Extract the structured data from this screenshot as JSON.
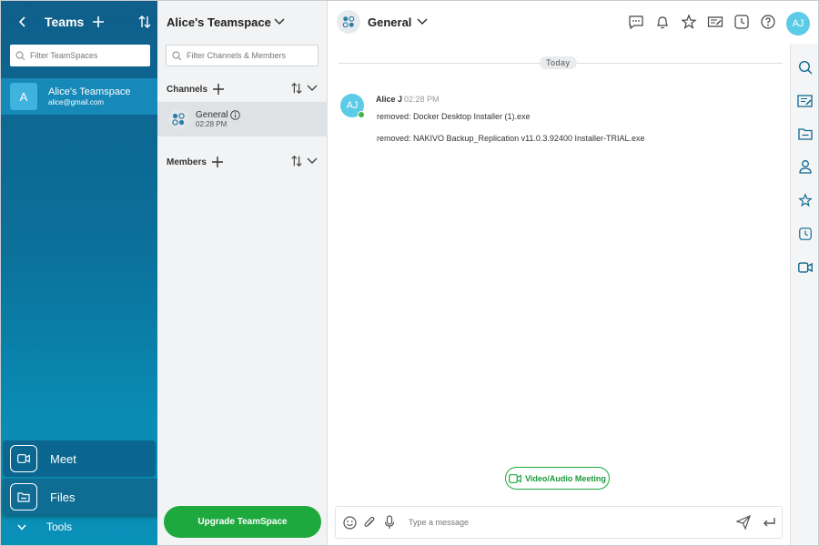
{
  "teams_panel": {
    "title": "Teams",
    "search_placeholder": "Filter TeamSpaces",
    "team": {
      "initial": "A",
      "name": "Alice's Teamspace",
      "email": "alice@gmail.com"
    },
    "meet_label": "Meet",
    "files_label": "Files",
    "tools_label": "Tools"
  },
  "channels_panel": {
    "title": "Alice's Teamspace",
    "search_placeholder": "Filter Channels & Members",
    "channels_section": "Channels",
    "members_section": "Members",
    "channel": {
      "name": "General",
      "time": "02:28 PM"
    },
    "upgrade_label": "Upgrade TeamSpace"
  },
  "chat": {
    "channel_name": "General",
    "user_initials": "AJ",
    "day_label": "Today",
    "message": {
      "initials": "AJ",
      "author": "Alice J",
      "time": "02:28 PM",
      "line1": "removed: Docker Desktop Installer (1).exe",
      "line2": "removed: NAKIVO Backup_Replication v11.0.3.92400 Installer-TRIAL.exe"
    },
    "meeting_label": "Video/Audio Meeting",
    "composer_placeholder": "Type a message"
  },
  "header_icons": [
    "chat-icon",
    "bell-icon",
    "star-icon",
    "edit-list-icon",
    "clock-icon",
    "help-icon"
  ],
  "rail_icons": [
    "search-icon",
    "notes-icon",
    "folder-icon",
    "person-icon",
    "star-icon",
    "clock-icon",
    "video-icon"
  ],
  "colors": {
    "sidebar_top": "#0f5f8a",
    "sidebar_bottom": "#0a91b8",
    "accent_green": "#1ea93f",
    "avatar": "#5ccbe8"
  }
}
